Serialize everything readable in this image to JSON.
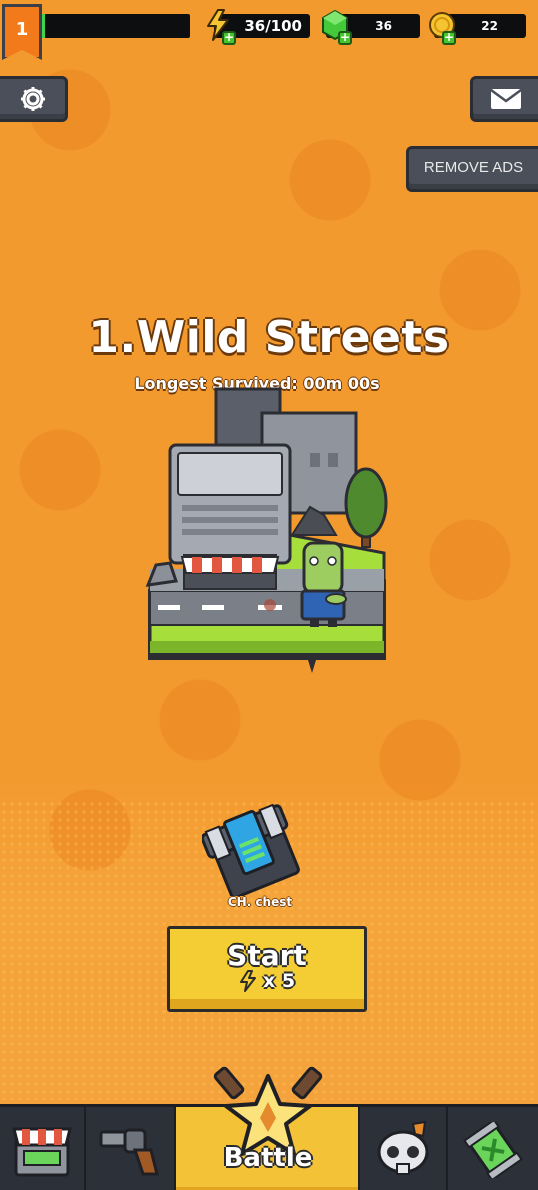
{
  "player": {
    "level": "1",
    "xp_fraction": 0.03
  },
  "resources": {
    "energy": "36/100",
    "gems": "36",
    "coins": "22"
  },
  "buttons": {
    "remove_ads": "REMOVE ADS"
  },
  "stage": {
    "title": "1.Wild Streets",
    "longest_survived": "Longest Survived: 00m 00s"
  },
  "reward": {
    "chest_label": "CH. chest"
  },
  "start": {
    "label": "Start",
    "cost": "x 5"
  },
  "nav": {
    "battle_label": "Battle"
  },
  "colors": {
    "background": "#f39a2f",
    "start_button": "#f4cc33",
    "nav_bar": "#2c3038",
    "active_tab": "#f4c237"
  },
  "icons": [
    "settings-gear-icon",
    "mail-envelope-icon",
    "energy-bolt-icon",
    "gem-icon",
    "coin-icon",
    "shop-icon",
    "revolver-icon",
    "battle-star-icon",
    "skull-icon",
    "battle-pass-icon"
  ]
}
